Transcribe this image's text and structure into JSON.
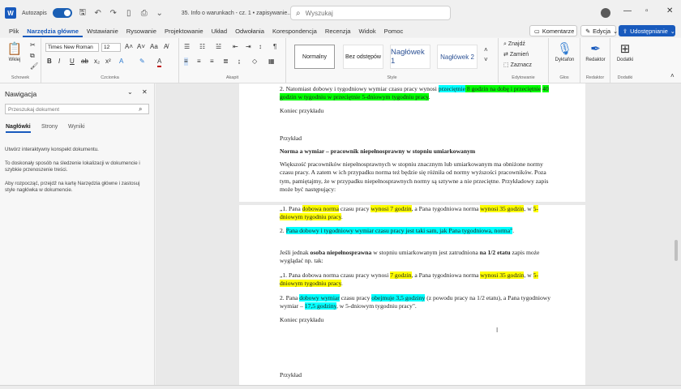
{
  "titlebar": {
    "app_icon": "W",
    "autosave_label": "Autozapis",
    "doc_title": "35. Info o warunkach - cz. 1 • zapisywanie...",
    "search_placeholder": "Wyszukaj",
    "icons": [
      "save-icon",
      "undo-icon",
      "redo-icon",
      "file-icon",
      "print-icon",
      "chevron-down-icon",
      "search-icon",
      "user-icon"
    ]
  },
  "menu": {
    "items": [
      "Plik",
      "Narzędzia główne",
      "Wstawianie",
      "Rysowanie",
      "Projektowanie",
      "Układ",
      "Odwołania",
      "Korespondencja",
      "Recenzja",
      "Widok",
      "Pomoc"
    ],
    "active": "Narzędzia główne",
    "comments_label": "Komentarze",
    "edit_label": "Edycja",
    "share_label": "Udostępnianie"
  },
  "ribbon": {
    "paste_label": "Wklej",
    "clipboard_label": "Schowek",
    "font_name": "Times New Roman",
    "font_size": "12",
    "font_group_label": "Czcionka",
    "paragraph_label": "Akapit",
    "styles_label": "Style",
    "styles": [
      "Normalny",
      "Bez odstępów",
      "Nagłówek 1",
      "Nagłówek 2"
    ],
    "find_label": "Znajdź",
    "replace_label": "Zamień",
    "select_label": "Zaznacz",
    "editing_label": "Edytowanie",
    "dictate_label": "Dyktafon",
    "voice_label": "Głos",
    "editor_label": "Redaktor",
    "editor_group_label": "Redaktor",
    "addins_label": "Dodatki",
    "addins_group_label": "Dodatki"
  },
  "navigation": {
    "title": "Nawigacja",
    "search_placeholder": "Przeszukaj dokument",
    "tabs": [
      "Nagłówki",
      "Strony",
      "Wyniki"
    ],
    "active_tab": "Nagłówki",
    "text1": "Utwórz interaktywny konspekt dokumentu.",
    "text2": "To doskonały sposób na śledzenie lokalizacji w dokumencie i szybkie przenoszenie treści.",
    "text3": "Aby rozpocząć, przejdź na kartę Narzędzia główne i zastosuj style nagłówka w dokumencie."
  },
  "document": {
    "p1_a": "2. Natomiast dobowy i tygodniowy wymiar czasu pracy wynosi ",
    "p1_hc": "przeciętnie",
    "p1_hg1": " 8 godzin na dobę i przeciętnie",
    "p1_sp": " ",
    "p1_hg2": "40 godzin w tygodniu w przeciętnie 5-dniowym tygodniu pracy",
    "p1_end": ".",
    "p2": "Koniec przykładu",
    "p3": "Przykład",
    "p4": "Norma a wymiar – pracownik niepełnosprawny w stopniu umiarkowanym",
    "p5": "Większość pracowników niepełnosprawnych w stopniu znacznym lub umiarkowanym ma obniżone normy czasu pracy. A zatem w ich przypadku norma też będzie się różniła od normy wyższości pracowników. Poza tym, pamiętajmy, że w przypadku niepełnosprawnych normy są sztywne a nie przeciętne. Przykładowy zapis może być następujący:",
    "p6_a": "„1. Pana ",
    "p6_y1": "dobowa norma",
    "p6_b": " czasu pracy ",
    "p6_y2": "wynosi 7 godzin",
    "p6_c": ", a Pana tygodniowa norma ",
    "p6_y3": "wynosi 35 godzin",
    "p6_d": ", w ",
    "p6_y4": "5-dniowym tygodniu pracy",
    "p6_e": ".",
    "p7_a": "2. ",
    "p7_c": "Pana dobowy i tygodniowy wymiar czasu pracy jest taki sam, jak Pana tygodniowa, norma\"",
    "p7_e": ".",
    "p8_a": "Jeśli jednak ",
    "p8_b": "osoba niepełnosprawna",
    "p8_c": " w stopniu umiarkowanym jest zatrudniona ",
    "p8_d": "na 1/2 etatu",
    "p8_e": " zapis może wyglądać np. tak:",
    "p9_a": "„1. Pana dobowa norma czasu pracy wynosi ",
    "p9_y1": "7 godzin",
    "p9_b": ", a Pana tygodniowa norma ",
    "p9_y2": "wynosi 35 godzin",
    "p9_c": ", w ",
    "p9_y3": "5-dniowym tygodniu pracy",
    "p9_d": ".",
    "p10_a": "2. Pana ",
    "p10_c1": "dobowy wymiar",
    "p10_b": " czasu pracy ",
    "p10_c2": "obejmuje 3,5 godziny",
    "p10_c": " (z powodu pracy na 1/2 etatu), a Pana tygodniowy wymiar – ",
    "p10_c3": "17,5 godziny",
    "p10_d": ", w 5-dniowym tygodniu pracy\".",
    "p11": "Koniec przykładu",
    "p12": "Przykład"
  }
}
